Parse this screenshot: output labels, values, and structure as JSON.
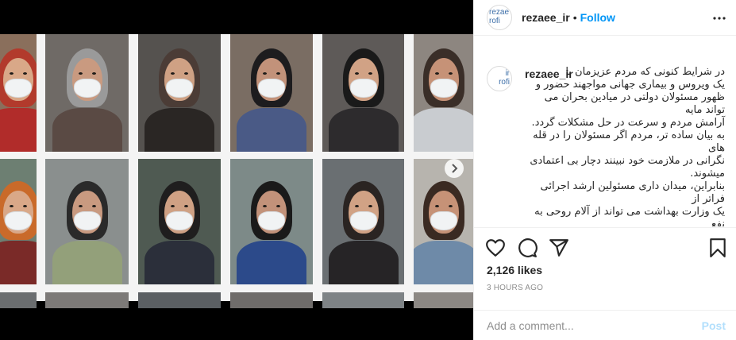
{
  "post": {
    "username": "rezaee_ir",
    "separator": "•",
    "follow_label": "Follow",
    "more_icon": "more-horizontal-icon",
    "avatar_text": "rezae\nrofi",
    "caption_username": "rezaee_ir",
    "caption_avatar_text": "ir\nrofi",
    "caption": "در شرایط کنونی که مردم عزیزمان با\nیک ویروس و بیماری جهانی مواجهند حضور و\nظهور مسئولان دولتی در میادین بحران می تواند مایه\nآرامش مردم و سرعت در حل مشکلات گردد.\nبه بیان ساده تر، مردم اگر مسئولان را در قله های\nنگرانی در ملازمت خود نبینند دچار بی اعتمادی\nمیشوند.\nبنابراین، میدان داری مسئولین ارشد اجرائی فراتر از\nیک وزارت بهداشت می تواند از آلام روحی به نفع\nروان سازی تدبیر امور و امیدافزایی برای عبور از\nاین دوره بکاهد و تجربه ای بالنده را به بار بنشاند.",
    "likes": "2,126 likes",
    "timestamp": "3 HOURS AGO",
    "comment_placeholder": "Add a comment...",
    "post_label": "Post",
    "icons": [
      "heart-icon",
      "comment-icon",
      "share-icon",
      "bookmark-icon",
      "chevron-right-icon"
    ]
  },
  "colors": {
    "accent": "#0095f6",
    "post_disabled": "#b2dffc",
    "muted": "#8e8e8e",
    "border": "#efefef"
  }
}
